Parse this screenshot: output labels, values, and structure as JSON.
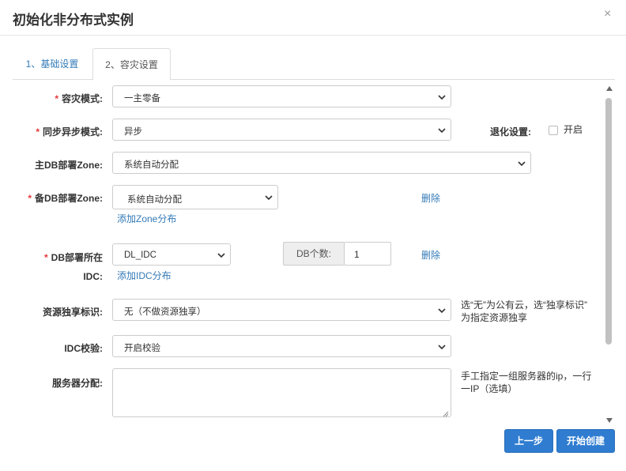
{
  "dialog": {
    "title": "初始化非分布式实例",
    "close_glyph": "×"
  },
  "tabs": [
    {
      "label": "1、基础设置",
      "active": false
    },
    {
      "label": "2、容灾设置",
      "active": true
    }
  ],
  "form": {
    "dr_mode": {
      "label": "容灾模式:",
      "required": true,
      "value": "一主零备"
    },
    "sync_mode": {
      "label": "同步异步模式:",
      "required": true,
      "value": "异步"
    },
    "degrade": {
      "label": "退化设置:",
      "checkbox_label": "开启",
      "checked": false
    },
    "primary_zone": {
      "label": "主DB部署Zone:",
      "required": false,
      "value": "系统自动分配"
    },
    "standby_zone": {
      "label": "备DB部署Zone:",
      "required": true,
      "value": "系统自动分配",
      "delete_label": "删除",
      "add_label": "添加Zone分布"
    },
    "db_idc": {
      "label_line1": "DB部署所在",
      "label_line2": "IDC:",
      "required": true,
      "value": "DL_IDC",
      "count_addon": "DB个数:",
      "count_value": "1",
      "delete_label": "删除",
      "add_label": "添加IDC分布"
    },
    "resource_exclusive": {
      "label": "资源独享标识:",
      "value": "无（不做资源独享）",
      "hint_line1": "选“无”为公有云，选“独享标识”",
      "hint_line2": "为指定资源独享"
    },
    "idc_check": {
      "label": "IDC校验:",
      "value": "开启校验"
    },
    "server_alloc": {
      "label": "服务器分配:",
      "value": "",
      "hint_line1": "手工指定一组服务器的ip，一行",
      "hint_line2": "一IP（选填）"
    }
  },
  "footer": {
    "prev_label": "上一步",
    "create_label": "开始创建"
  },
  "colors": {
    "link": "#337ab7",
    "primary_button": "#2f7cd0",
    "required": "#e4393c"
  }
}
